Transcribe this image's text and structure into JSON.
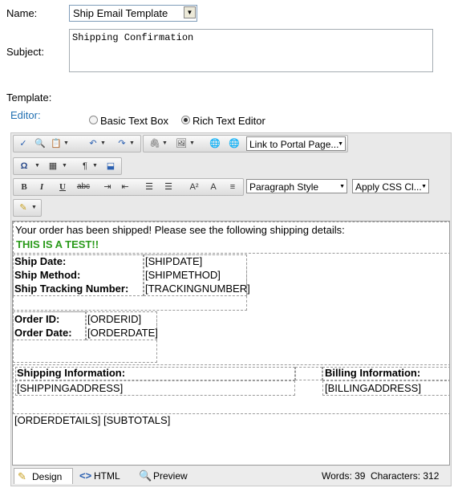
{
  "form": {
    "name_label": "Name:",
    "name_value": "Ship Email Template",
    "subject_label": "Subject:",
    "subject_value": "Shipping Confirmation",
    "template_label": "Template:",
    "editor_label": "Editor:",
    "radio_basic": "Basic Text Box",
    "radio_rich": "Rich Text Editor",
    "selected_editor": "Rich Text Editor"
  },
  "toolbar": {
    "link_portal_page": "Link to Portal Page...",
    "paragraph_style": "Paragraph Style",
    "apply_css": "Apply CSS Cl...",
    "bold": "B",
    "italic": "I",
    "underline": "U",
    "strike": "abc",
    "omega": "Ω"
  },
  "content": {
    "intro": "Your order has been shipped! Please see the following shipping details:",
    "test": "THIS IS A TEST!!",
    "ship_date_label": "Ship Date:",
    "ship_date_value": "[SHIPDATE]",
    "ship_method_label": "Ship Method:",
    "ship_method_value": "[SHIPMETHOD]",
    "tracking_label": "Ship Tracking Number:",
    "tracking_value": "[TRACKINGNUMBER]",
    "order_id_label": "Order ID:",
    "order_id_value": "[ORDERID]",
    "order_date_label": "Order Date:",
    "order_date_value": "[ORDERDATE]",
    "shipping_info_label": "Shipping Information:",
    "shipping_address": "[SHIPPINGADDRESS]",
    "billing_info_label": "Billing Information:",
    "billing_address": "[BILLINGADDRESS]",
    "order_details": "[ORDERDETAILS] [SUBTOTALS]"
  },
  "bottom_bar": {
    "design_tab": "Design",
    "html_tab": "HTML",
    "preview_tab": "Preview",
    "words": "Words: 39",
    "characters": "Characters: 312"
  }
}
